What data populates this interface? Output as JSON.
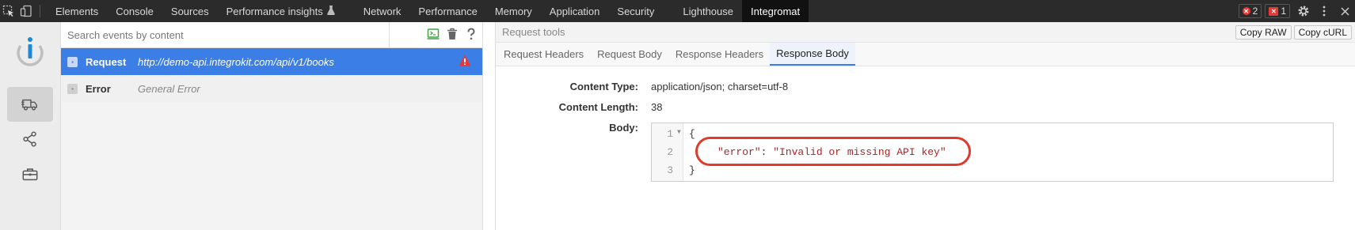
{
  "devtools": {
    "tabs": [
      "Elements",
      "Console",
      "Sources",
      "Performance insights",
      "Network",
      "Performance",
      "Memory",
      "Application",
      "Security",
      "Lighthouse",
      "Integromat"
    ],
    "active_tab": "Integromat",
    "error_count": "2",
    "issue_count": "1",
    "experimental_icon": "flask-icon"
  },
  "events": {
    "search_placeholder": "Search events by content",
    "items": [
      {
        "type": "Request",
        "desc": "http://demo-api.integrokit.com/api/v1/books",
        "warning": true
      },
      {
        "type": "Error",
        "desc": "General Error",
        "warning": false
      }
    ]
  },
  "tools": {
    "title": "Request tools",
    "copy_raw": "Copy RAW",
    "copy_curl": "Copy cURL",
    "tabs": [
      "Request Headers",
      "Request Body",
      "Response Headers",
      "Response Body"
    ],
    "active_tab": "Response Body",
    "content_type_label": "Content Type:",
    "content_type_value": "application/json; charset=utf-8",
    "content_length_label": "Content Length:",
    "content_length_value": "38",
    "body_label": "Body:",
    "code": {
      "line_numbers": [
        "1",
        "2",
        "3"
      ],
      "open_brace": "{",
      "key": "\"error\"",
      "colon": ": ",
      "value": "\"Invalid or missing API key\"",
      "close_brace": "}"
    }
  },
  "colors": {
    "accent": "#3b7ee6",
    "highlight": "#e03a2c",
    "devbar": "#2b2b2b"
  }
}
